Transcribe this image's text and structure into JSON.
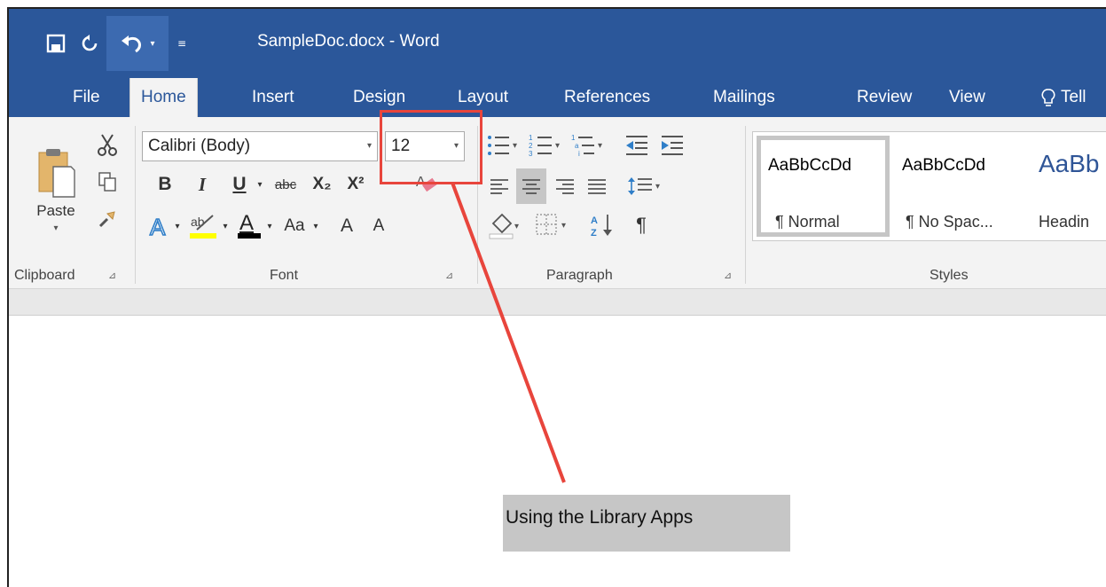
{
  "window": {
    "title": "SampleDoc.docx - Word"
  },
  "tabs": [
    {
      "label": "File"
    },
    {
      "label": "Home"
    },
    {
      "label": "Insert"
    },
    {
      "label": "Design"
    },
    {
      "label": "Layout"
    },
    {
      "label": "References"
    },
    {
      "label": "Mailings"
    },
    {
      "label": "Review"
    },
    {
      "label": "View"
    },
    {
      "label": "Tell"
    }
  ],
  "active_tab": "Home",
  "ribbon": {
    "clipboard": {
      "paste_label": "Paste",
      "group_label": "Clipboard"
    },
    "font": {
      "font_name": "Calibri (Body)",
      "font_size": "12",
      "bold": "B",
      "italic": "I",
      "underline": "U",
      "strike": "abc",
      "subscript": "X₂",
      "superscript": "X²",
      "change_case": "Aa",
      "grow": "A",
      "shrink": "A",
      "group_label": "Font"
    },
    "paragraph": {
      "group_label": "Paragraph",
      "pilcrow": "¶"
    },
    "styles": {
      "group_label": "Styles",
      "items": [
        {
          "sample": "AaBbCcDd",
          "name": "¶ Normal"
        },
        {
          "sample": "AaBbCcDd",
          "name": "¶ No Spac..."
        },
        {
          "sample": "AaBb",
          "name": "Headin"
        }
      ]
    }
  },
  "document": {
    "text": "Using the Library Apps"
  },
  "colors": {
    "title_bar": "#2b579a",
    "annotation": "#e8453c",
    "highlight": "#ffff00",
    "font_color": "#000000"
  }
}
